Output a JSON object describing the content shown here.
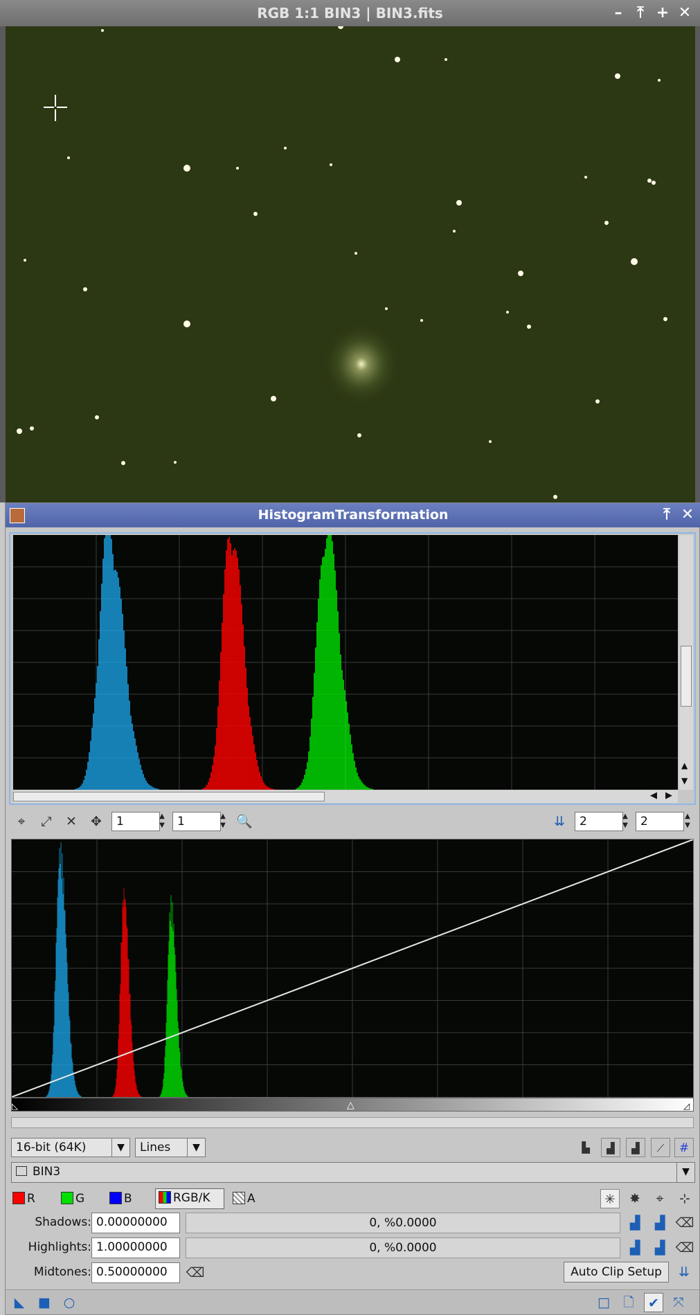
{
  "image_window": {
    "title": "RGB 1:1 BIN3 | BIN3.fits",
    "controls": [
      "minimize-icon",
      "shade-icon",
      "maximize-icon",
      "close-icon"
    ]
  },
  "histogram_transformation": {
    "title": "HistogramTransformation",
    "toolbar": {
      "zoom_x": "1",
      "zoom_y": "1",
      "lower_zoom_x": "2",
      "lower_zoom_y": "2"
    },
    "resolution": {
      "selected": "16-bit (64K)"
    },
    "graph_style": {
      "selected": "Lines"
    },
    "view": {
      "selected": "BIN3"
    },
    "channels": {
      "r": "R",
      "g": "G",
      "b": "B",
      "rgbk": "RGB/K",
      "a": "A",
      "colors": {
        "r": "#ff0000",
        "g": "#00e000",
        "b": "#0000ff",
        "blue_hist": "#1a9fe0"
      }
    },
    "shadows": {
      "label": "Shadows:",
      "value": "0.00000000",
      "clip": "0, %0.0000"
    },
    "highlights": {
      "label": "Highlights:",
      "value": "1.00000000",
      "clip": "0, %0.0000"
    },
    "midtones": {
      "label": "Midtones:",
      "value": "0.50000000"
    },
    "auto_clip": "Auto Clip Setup"
  }
}
